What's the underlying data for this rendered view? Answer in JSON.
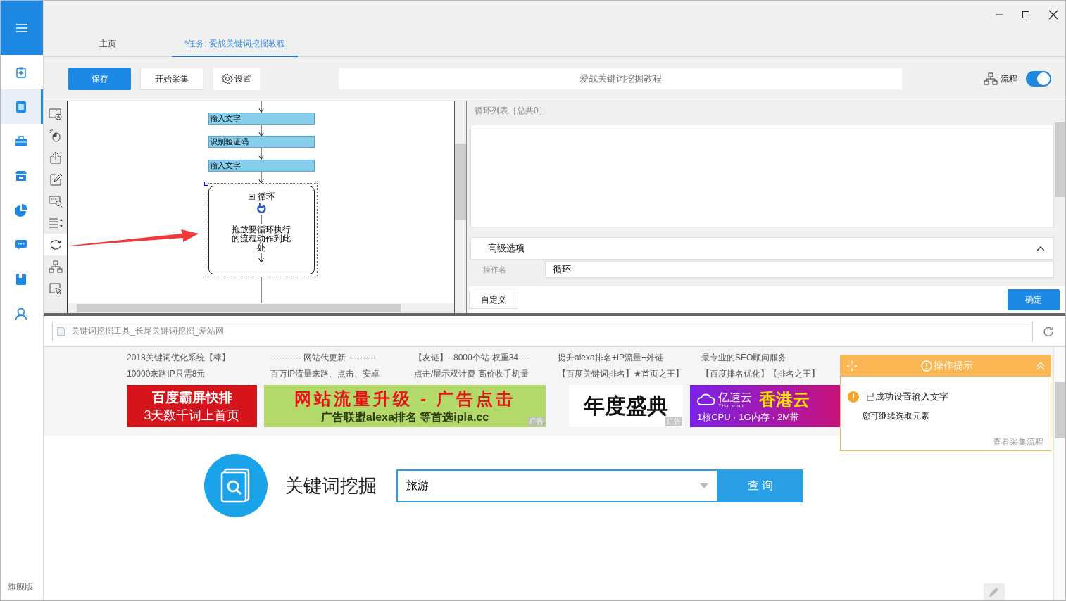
{
  "sidebar": {
    "items": [
      {
        "selected": false
      },
      {
        "selected": true
      },
      {
        "selected": false
      },
      {
        "selected": false
      },
      {
        "selected": false
      },
      {
        "selected": false
      },
      {
        "selected": false
      },
      {
        "selected": false
      }
    ],
    "edition": "旗舰版"
  },
  "tabs": [
    {
      "label": "主页",
      "selected": false
    },
    {
      "label": "*任务: 爱战关键词挖掘教程",
      "selected": true
    }
  ],
  "toolbar": {
    "buttons": [
      {
        "label": "保存",
        "kind": "primary"
      },
      {
        "label": "开始采集",
        "kind": "plain"
      },
      {
        "label": "设置",
        "kind": "settings"
      }
    ],
    "task_name": "爱战关键词挖掘教程",
    "flow_switch": {
      "label": "流程",
      "on": true
    }
  },
  "tools": [
    {
      "selected": false
    },
    {
      "selected": false
    },
    {
      "selected": false
    },
    {
      "selected": false
    },
    {
      "selected": false
    },
    {
      "selected": false
    },
    {
      "selected": true
    },
    {
      "selected": false
    },
    {
      "selected": false
    }
  ],
  "flowchart": {
    "steps": [
      {
        "kind": "action",
        "label": "输入文字"
      },
      {
        "kind": "action",
        "label": "识别验证码"
      },
      {
        "kind": "action",
        "label": "输入文字"
      },
      {
        "kind": "loop",
        "label": "循环",
        "hint": "拖放要循环执行的流程动作到此处",
        "selected": true
      }
    ]
  },
  "loop_panel": {
    "list_title": "循环列表［总共0］",
    "section": {
      "title": "高级选项",
      "expanded": true
    },
    "field": {
      "label": "操作名",
      "value": "循环"
    },
    "custom_button": "自定义",
    "ok_button": "确定"
  },
  "browser": {
    "url": "关键词挖掘工具_长尾关键词挖掘_爱站网"
  },
  "ads": [
    {
      "lines": [
        "2018关键词优化系统【棒】",
        "10000来路IP只需8元"
      ]
    },
    {
      "lines": [
        "----------- 网站代更新 ----------",
        "百万IP流量来路、点击、安卓"
      ]
    },
    {
      "lines": [
        "【友链】--8000个站-权重34----",
        "点击/展示双计费 高价收手机量"
      ]
    },
    {
      "lines": [
        "提升alexa排名+IP流量+外链",
        "【百度关键词排名】★首页之王】"
      ]
    },
    {
      "lines": [
        "最专业的SEO顾问服务",
        "【百度排名优化】【排名之王】"
      ]
    }
  ],
  "banners": [
    {
      "kind": "red",
      "lines": [
        "百度霸屏快排",
        "3天数千词上首页"
      ]
    },
    {
      "kind": "green",
      "lines": [
        "网站流量升级 - 广告点击",
        "广告联盟alexa排名 等首选ipla.cc"
      ],
      "tag": "广告"
    },
    {
      "kind": "calligraphy",
      "lines": [
        "年度盛典"
      ],
      "tag": "广告"
    },
    {
      "kind": "purple",
      "lines": [
        "亿速云",
        "Yisu.com",
        "香港云",
        "1核CPU · 1G内存 · 2M带"
      ]
    }
  ],
  "tip": {
    "title": "操作提示",
    "message": "已成功设置输入文字",
    "detail": "您可继续选取元素",
    "link": "查看采集流程"
  },
  "search": {
    "title": "关键词挖掘",
    "value": "旅游",
    "button": "查 询"
  }
}
